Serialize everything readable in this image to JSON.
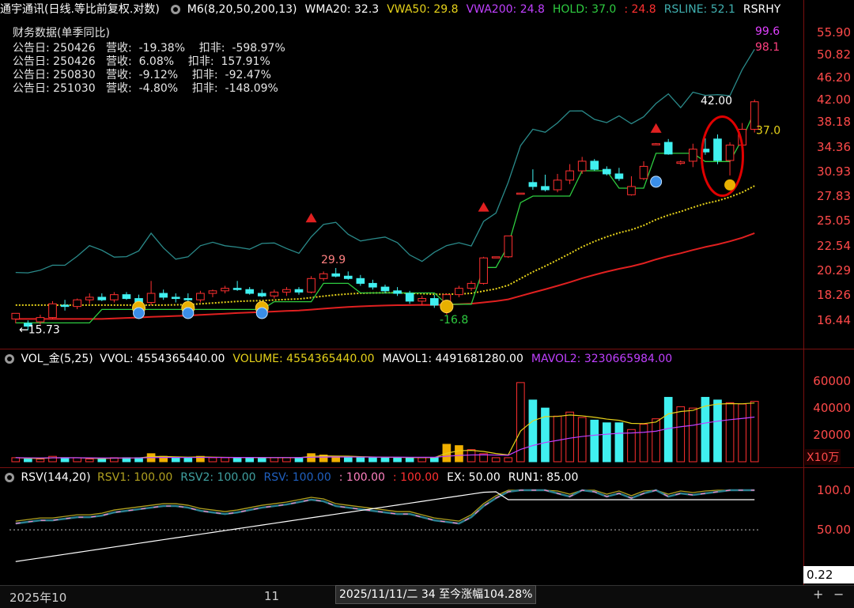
{
  "header": {
    "title": "通宇通讯(日线.等比前复权.对数)",
    "items": [
      {
        "text": "M6(8,20,50,200,13)",
        "color": "#ffffff"
      },
      {
        "text": "WMA20: 32.3",
        "color": "#ffffff"
      },
      {
        "text": "VWA50: 29.8",
        "color": "#e6d21a"
      },
      {
        "text": "VWA200: 24.8",
        "color": "#c040ff"
      },
      {
        "text": "HOLD: 37.0",
        "color": "#2ecc40"
      },
      {
        "text": ": 24.8",
        "color": "#ff3030"
      },
      {
        "text": "RSLINE: 52.1",
        "color": "#40b0b0"
      },
      {
        "text": "RSRHY",
        "color": "#ffffff"
      }
    ]
  },
  "financials": {
    "title": "财务数据(单季同比)",
    "rows": [
      "公告日: 250426   营收:  -19.38%    扣非:  -598.97%",
      "公告日: 250426   营收:  6.08%    扣非:  157.91%",
      "公告日: 250830   营收:  -9.12%    扣非:  -92.47%",
      "公告日: 251030   营收:  -4.80%    扣非:  -148.09%"
    ]
  },
  "price_axis": [
    "55.90",
    "50.82",
    "46.20",
    "42.00",
    "38.18",
    "34.36",
    "30.93",
    "27.83",
    "25.05",
    "22.54",
    "20.29",
    "18.26",
    "16.44"
  ],
  "annotations": {
    "top1": "99.6",
    "top2": "98.1",
    "hi": "42.00",
    "hold": "37.0",
    "peak": "29.9",
    "low1": "-16.8",
    "low0": "←15.73"
  },
  "volume_header": {
    "title": "VOL_金(5,25)",
    "items": [
      {
        "text": "VVOL: 4554365440.00",
        "color": "#ffffff"
      },
      {
        "text": "VOLUME: 4554365440.00",
        "color": "#e6d21a"
      },
      {
        "text": "MAVOL1: 4491681280.00",
        "color": "#ffffff"
      },
      {
        "text": "MAVOL2: 3230665984.00",
        "color": "#c040ff"
      }
    ]
  },
  "volume_axis": [
    "60000",
    "40000",
    "20000"
  ],
  "volume_unit": "X10万",
  "rsv_header": {
    "title": "RSV(144,20)",
    "items": [
      {
        "text": "RSV1: 100.00",
        "color": "#b0a020"
      },
      {
        "text": "RSV2: 100.00",
        "color": "#40a0a0"
      },
      {
        "text": "RSV: 100.00",
        "color": "#2060c0"
      },
      {
        "text": ": 100.00",
        "color": "#ff80c0"
      },
      {
        "text": ": 100.00",
        "color": "#ff3030"
      },
      {
        "text": "EX: 50.00",
        "color": "#ffffff"
      },
      {
        "text": "RUN1: 85.00",
        "color": "#ffffff"
      }
    ]
  },
  "rsv_axis": [
    "100.0",
    "50.00"
  ],
  "rsv_current": "0.22",
  "footer": {
    "date_left": "2025年10",
    "date_mid": "11",
    "tooltip": "2025/11/11/二 34 至今涨幅104.28%",
    "zoom_plus": "+",
    "zoom_minus": "−"
  },
  "chart_data": {
    "type": "candlestick",
    "title": "通宇通讯(日线.等比前复权.对数)",
    "y_scale": "log",
    "ylim": [
      15.5,
      58
    ],
    "candles": [
      {
        "o": 16.5,
        "h": 16.9,
        "l": 16.2,
        "c": 16.9
      },
      {
        "o": 16.2,
        "h": 16.4,
        "l": 15.73,
        "c": 16.0
      },
      {
        "o": 16.3,
        "h": 16.8,
        "l": 16.1,
        "c": 16.6
      },
      {
        "o": 16.6,
        "h": 17.8,
        "l": 16.5,
        "c": 17.6
      },
      {
        "o": 17.5,
        "h": 17.9,
        "l": 17.1,
        "c": 17.4
      },
      {
        "o": 17.4,
        "h": 18.0,
        "l": 17.2,
        "c": 17.9
      },
      {
        "o": 17.9,
        "h": 18.4,
        "l": 17.6,
        "c": 18.1
      },
      {
        "o": 18.1,
        "h": 18.4,
        "l": 17.8,
        "c": 17.9
      },
      {
        "o": 17.9,
        "h": 18.5,
        "l": 17.7,
        "c": 18.3
      },
      {
        "o": 18.3,
        "h": 18.5,
        "l": 17.9,
        "c": 18.0
      },
      {
        "o": 18.0,
        "h": 18.3,
        "l": 17.6,
        "c": 17.7
      },
      {
        "o": 17.7,
        "h": 19.4,
        "l": 17.5,
        "c": 18.4
      },
      {
        "o": 18.4,
        "h": 18.7,
        "l": 17.9,
        "c": 18.1
      },
      {
        "o": 18.1,
        "h": 18.4,
        "l": 17.7,
        "c": 18.0
      },
      {
        "o": 18.0,
        "h": 18.4,
        "l": 17.6,
        "c": 17.9
      },
      {
        "o": 17.9,
        "h": 18.6,
        "l": 17.7,
        "c": 18.4
      },
      {
        "o": 18.4,
        "h": 18.7,
        "l": 18.1,
        "c": 18.6
      },
      {
        "o": 18.6,
        "h": 19.0,
        "l": 18.4,
        "c": 18.8
      },
      {
        "o": 18.8,
        "h": 19.4,
        "l": 18.6,
        "c": 18.7
      },
      {
        "o": 18.7,
        "h": 18.9,
        "l": 18.3,
        "c": 18.4
      },
      {
        "o": 18.4,
        "h": 18.7,
        "l": 18.1,
        "c": 18.2
      },
      {
        "o": 18.2,
        "h": 18.7,
        "l": 18.0,
        "c": 18.5
      },
      {
        "o": 18.5,
        "h": 18.9,
        "l": 18.2,
        "c": 18.7
      },
      {
        "o": 18.7,
        "h": 18.9,
        "l": 18.3,
        "c": 18.5
      },
      {
        "o": 18.5,
        "h": 19.8,
        "l": 18.4,
        "c": 19.6
      },
      {
        "o": 19.6,
        "h": 20.2,
        "l": 19.4,
        "c": 20.0
      },
      {
        "o": 20.0,
        "h": 20.5,
        "l": 19.7,
        "c": 19.8
      },
      {
        "o": 19.8,
        "h": 20.2,
        "l": 19.5,
        "c": 19.6
      },
      {
        "o": 19.6,
        "h": 19.9,
        "l": 19.0,
        "c": 19.2
      },
      {
        "o": 19.2,
        "h": 19.5,
        "l": 18.7,
        "c": 18.9
      },
      {
        "o": 18.9,
        "h": 19.1,
        "l": 18.4,
        "c": 18.6
      },
      {
        "o": 18.6,
        "h": 18.9,
        "l": 18.2,
        "c": 18.4
      },
      {
        "o": 18.4,
        "h": 18.6,
        "l": 17.6,
        "c": 17.8
      },
      {
        "o": 17.8,
        "h": 18.2,
        "l": 17.5,
        "c": 18.0
      },
      {
        "o": 18.0,
        "h": 18.3,
        "l": 17.3,
        "c": 17.5
      },
      {
        "o": 17.5,
        "h": 18.4,
        "l": 16.8,
        "c": 18.3
      },
      {
        "o": 18.3,
        "h": 19.0,
        "l": 18.1,
        "c": 18.8
      },
      {
        "o": 18.8,
        "h": 19.4,
        "l": 18.6,
        "c": 19.2
      },
      {
        "o": 19.2,
        "h": 21.5,
        "l": 19.1,
        "c": 21.4
      },
      {
        "o": 21.4,
        "h": 21.5,
        "l": 21.4,
        "c": 21.5
      },
      {
        "o": 21.5,
        "h": 23.5,
        "l": 21.4,
        "c": 23.5
      },
      {
        "o": 28.2,
        "h": 28.2,
        "l": 28.1,
        "c": 28.2
      },
      {
        "o": 29.5,
        "h": 31.2,
        "l": 28.6,
        "c": 29.0
      },
      {
        "o": 29.0,
        "h": 30.5,
        "l": 28.4,
        "c": 28.6
      },
      {
        "o": 28.6,
        "h": 30.6,
        "l": 28.3,
        "c": 29.8
      },
      {
        "o": 29.8,
        "h": 31.9,
        "l": 29.3,
        "c": 31.0
      },
      {
        "o": 31.0,
        "h": 32.9,
        "l": 30.6,
        "c": 32.3
      },
      {
        "o": 32.3,
        "h": 32.6,
        "l": 31.0,
        "c": 31.2
      },
      {
        "o": 31.2,
        "h": 31.6,
        "l": 30.4,
        "c": 30.6
      },
      {
        "o": 30.6,
        "h": 31.4,
        "l": 29.7,
        "c": 30.0
      },
      {
        "o": 28.0,
        "h": 30.3,
        "l": 27.9,
        "c": 29.0
      },
      {
        "o": 30.0,
        "h": 32.3,
        "l": 29.8,
        "c": 31.6
      },
      {
        "o": 34.8,
        "h": 34.9,
        "l": 34.7,
        "c": 34.8
      },
      {
        "o": 35.0,
        "h": 35.5,
        "l": 33.2,
        "c": 33.3
      },
      {
        "o": 32.0,
        "h": 32.4,
        "l": 31.8,
        "c": 32.2
      },
      {
        "o": 32.3,
        "h": 34.8,
        "l": 31.5,
        "c": 34.0
      },
      {
        "o": 34.0,
        "h": 35.6,
        "l": 33.2,
        "c": 33.6
      },
      {
        "o": 35.5,
        "h": 36.2,
        "l": 31.9,
        "c": 32.4
      },
      {
        "o": 32.4,
        "h": 35.0,
        "l": 30.4,
        "c": 34.6
      },
      {
        "o": 34.6,
        "h": 38.0,
        "l": 34.0,
        "c": 37.0
      },
      {
        "o": 37.0,
        "h": 42.0,
        "l": 36.5,
        "c": 41.6
      }
    ],
    "volume": [
      3,
      2,
      2,
      4,
      3,
      3,
      2,
      2,
      3,
      3,
      3,
      6,
      4,
      3,
      3,
      4,
      3,
      3,
      3,
      3,
      3,
      3,
      3,
      3,
      6,
      5,
      4,
      4,
      3,
      3,
      3,
      3,
      3,
      3,
      3,
      13,
      12,
      9,
      6,
      3,
      3,
      59,
      46,
      40,
      34,
      37,
      33,
      31,
      29,
      29,
      24,
      28,
      32,
      48,
      41,
      40,
      48,
      46,
      44,
      43,
      45
    ],
    "rsv": [
      58,
      60,
      62,
      62,
      64,
      66,
      66,
      68,
      72,
      74,
      76,
      78,
      80,
      80,
      78,
      74,
      72,
      70,
      72,
      75,
      78,
      80,
      82,
      85,
      88,
      86,
      80,
      78,
      76,
      74,
      72,
      70,
      70,
      66,
      62,
      60,
      58,
      66,
      80,
      90,
      98,
      100,
      100,
      100,
      96,
      92,
      100,
      98,
      92,
      96,
      90,
      96,
      100,
      92,
      96,
      94,
      96,
      98,
      100,
      100,
      100
    ],
    "ex": 50
  }
}
